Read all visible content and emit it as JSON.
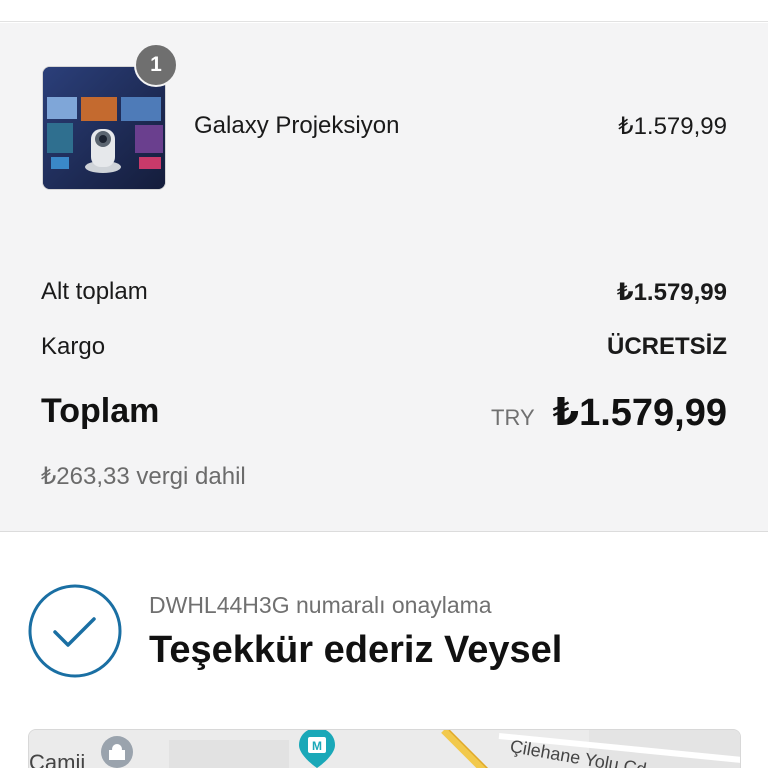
{
  "cart": {
    "item": {
      "name": "Galaxy Projeksiyon",
      "price": "₺1.579,99",
      "quantity": "1"
    }
  },
  "summary": {
    "subtotal_label": "Alt toplam",
    "subtotal_value": "₺1.579,99",
    "shipping_label": "Kargo",
    "shipping_value": "ÜCRETSİZ",
    "total_label": "Toplam",
    "total_currency": "TRY",
    "total_value": "₺1.579,99",
    "tax_note": "₺263,33 vergi dahil"
  },
  "confirmation": {
    "order_ref": "DWHL44H3G numaralı onaylama",
    "thanks": "Teşekkür ederiz Veysel"
  },
  "map": {
    "label_left": "Camii",
    "label_street": "Çilehane Yolu Cd."
  },
  "colors": {
    "check_accent": "#1a6fa3",
    "map_pin": "#1aa8b8",
    "map_road": "#f2c94c"
  }
}
